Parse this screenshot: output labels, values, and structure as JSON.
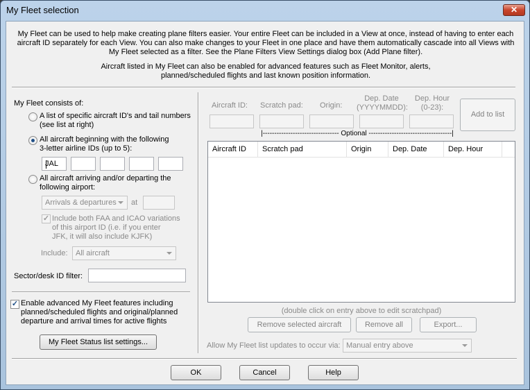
{
  "window": {
    "title": "My Fleet selection",
    "close_glyph": "✕"
  },
  "intro": {
    "para1": [
      "My Fleet can be used to help make creating plane filters easier.  Your entire Fleet can be included in a View at once, instead of having to enter each",
      "aircraft ID separately for each View.  You can also make changes to your Fleet in one place and have them automatically cascade into all Views with",
      "My Fleet selected as a filter.  See the Plane Filters View Settings dialog box (Add Plane filter)."
    ],
    "para2": [
      "Aircraft listed in My Fleet can also be enabled for advanced features such as Fleet Monitor, alerts,",
      "planned/scheduled flights and last known position information."
    ]
  },
  "fleet": {
    "heading": "My Fleet consists of:",
    "option_list": {
      "line1": "A list of specific aircraft ID's and tail numbers",
      "line2": "(see list at right)",
      "selected": false
    },
    "option_airline": {
      "line1": "All aircraft beginning with the following",
      "line2": "3-letter airline IDs (up to 5):",
      "selected": true,
      "codes": [
        "JAL",
        "",
        "",
        "",
        ""
      ]
    },
    "option_airport": {
      "line1": "All aircraft arriving and/or departing the",
      "line2": "following airport:",
      "selected": false,
      "direction": "Arrivals & departures",
      "at_label": "at",
      "airport": "",
      "include_faa_icao": {
        "line1": "Include both FAA and ICAO variations",
        "line2": "of this airport ID (i.e. if you enter",
        "line3": "JFK, it will also include KJFK)",
        "checked": true
      },
      "include_label": "Include:",
      "include_value": "All aircraft"
    },
    "sector_label": "Sector/desk ID filter:",
    "sector_value": ""
  },
  "advanced": {
    "checked": true,
    "line1": "Enable advanced My Fleet features including",
    "line2": "planned/scheduled flights and original/planned",
    "line3": "departure and arrival times for active flights",
    "status_button": "My Fleet Status list settings..."
  },
  "entry": {
    "aircraft_id_label": "Aircraft ID:",
    "scratch_label": "Scratch pad:",
    "origin_label": "Origin:",
    "dep_date_label1": "Dep. Date",
    "dep_date_label2": "(YYYYMMDD):",
    "dep_hour_label1": "Dep. Hour",
    "dep_hour_label2": "(0-23):",
    "add_button": "Add to list",
    "optional_label": "|--------------------------------- Optional ------------------------------------|"
  },
  "table": {
    "columns": [
      "Aircraft ID",
      "Scratch pad",
      "Origin",
      "Dep. Date",
      "Dep. Hour"
    ],
    "rows": []
  },
  "list_hint": "(double click on entry above to edit scratchpad)",
  "list_buttons": {
    "remove_selected": "Remove selected aircraft",
    "remove_all": "Remove all",
    "export": "Export..."
  },
  "updates": {
    "label": "Allow My Fleet list updates to occur via:",
    "value": "Manual entry above"
  },
  "footer": {
    "ok": "OK",
    "cancel": "Cancel",
    "help": "Help"
  },
  "colors": {
    "radio_dot": "#1f4f86",
    "titlebar": "#bcd3ea",
    "close": "#c9452c"
  }
}
